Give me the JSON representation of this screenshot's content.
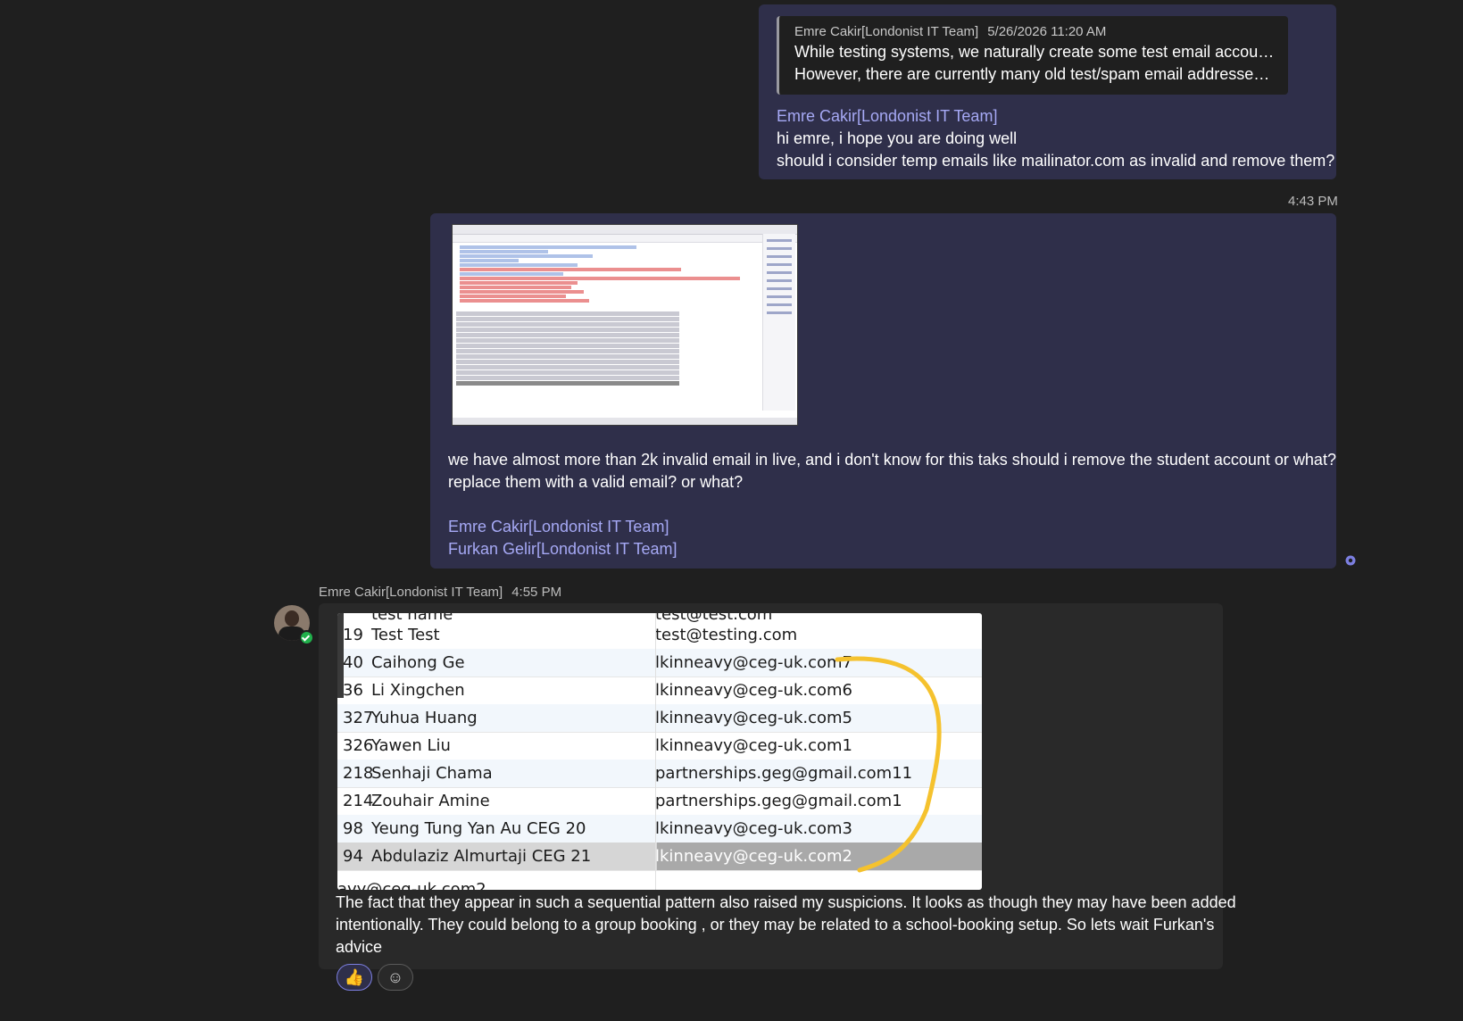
{
  "message1": {
    "quote": {
      "author": "Emre Cakir[Londonist IT Team]",
      "time": "5/26/2026 11:20 AM",
      "line1": "While testing systems, we naturally create some test email accounts.",
      "line2": "However, there are currently many old test/spam email addresses lef..."
    },
    "mention": "Emre Cakir[Londonist IT Team]",
    "line1": "hi emre, i hope you are doing well",
    "line2": "should i consider temp emails like mailinator.com as invalid and remove them?"
  },
  "message2": {
    "timestamp": "4:43 PM",
    "line1": "we have almost more than 2k invalid email in live, and i don't know for this taks should i remove the student account or what?",
    "line2": "replace them with a valid email? or what?",
    "mention1": "Emre Cakir[Londonist IT Team]",
    "mention2": "Furkan Gelir[Londonist IT Team]"
  },
  "message3": {
    "author": "Emre Cakir[Londonist IT Team]",
    "time": "4:55 PM",
    "screenshot": {
      "top_clip_name": "test name",
      "top_clip_email": "test@test.com",
      "rows": [
        {
          "id": "19",
          "name": "Test Test",
          "email": "test@testing.com"
        },
        {
          "id": "40",
          "name": "Caihong Ge",
          "email": "lkinneavy@ceg-uk.com7"
        },
        {
          "id": "36",
          "name": "Li Xingchen",
          "email": "lkinneavy@ceg-uk.com6"
        },
        {
          "id": "327",
          "name": "Yuhua Huang",
          "email": "lkinneavy@ceg-uk.com5"
        },
        {
          "id": "326",
          "name": "Yawen Liu",
          "email": "lkinneavy@ceg-uk.com1"
        },
        {
          "id": "218",
          "name": "Senhaji Chama",
          "email": "partnerships.geg@gmail.com11"
        },
        {
          "id": "214",
          "name": "Zouhair Amine",
          "email": "partnerships.geg@gmail.com1"
        },
        {
          "id": "98",
          "name": "Yeung Tung Yan Au CEG 20",
          "email": "lkinneavy@ceg-uk.com3"
        },
        {
          "id": "94",
          "name": "Abdulaziz Almurtaji CEG 21",
          "email": "lkinneavy@ceg-uk.com2"
        }
      ],
      "bottom_clip": "avy@ceg-uk.com2"
    },
    "line1": "The fact that they appear in such a sequential pattern also raised my suspicions. It looks as though they may have been added",
    "line2": "intentionally. They could belong to a group booking , or they may be related to a school-booking setup. So lets wait Furkan's",
    "line3": "advice"
  },
  "reactions": {
    "like_icon": "👍",
    "add_icon": "☺"
  },
  "colors": {
    "background": "#1f1f1f",
    "outgoing_bubble": "#2f2f4a",
    "incoming_bubble": "#292929",
    "mention": "#a6a9f5",
    "annotation": "#f5c22e"
  }
}
